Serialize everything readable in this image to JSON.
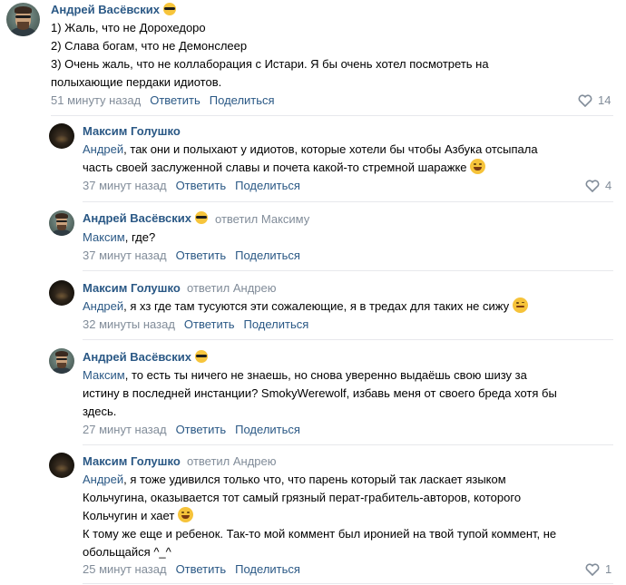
{
  "comments": [
    {
      "author": "Андрей Васёвских",
      "lines": [
        "1) Жаль, что не Дорохедоро",
        "2) Слава богам, что не Демонслеер",
        "3) Очень жаль, что не коллаборация с Истари. Я бы очень хотел посмотреть на",
        "полыхающие пердаки идиотов."
      ],
      "time": "51 минуту назад",
      "reply": "Ответить",
      "share": "Поделиться",
      "likes": "14"
    },
    {
      "author": "Максим Голушко",
      "mention": "Андрей",
      "lines": [
        ", так они и полыхают у идиотов, которые хотели бы чтобы Азбука отсыпала",
        "часть своей заслуженной славы и почета какой-то стремной шаражке"
      ],
      "time": "37 минут назад",
      "reply": "Ответить",
      "share": "Поделиться",
      "likes": "4"
    },
    {
      "author": "Андрей Васёвских",
      "reply_to": "ответил Максиму",
      "mention": "Максим",
      "text": ", где?",
      "time": "37 минут назад",
      "reply": "Ответить",
      "share": "Поделиться"
    },
    {
      "author": "Максим Голушко",
      "reply_to": "ответил Андрею",
      "mention": "Андрей",
      "text": ", я хз где там тусуются эти сожалеющие, я в тредах для таких не сижу",
      "time": "32 минуты назад",
      "reply": "Ответить",
      "share": "Поделиться"
    },
    {
      "author": "Андрей Васёвских",
      "mention": "Максим",
      "lines": [
        ", то есть ты ничего не знаешь, но снова уверенно выдаёшь свою шизу за",
        "истину в последней инстанции? SmokyWerewolf, избавь меня от своего бреда хотя бы",
        "здесь."
      ],
      "time": "27 минут назад",
      "reply": "Ответить",
      "share": "Поделиться"
    },
    {
      "author": "Максим Голушко",
      "reply_to": "ответил Андрею",
      "mention": "Андрей",
      "lines": [
        ", я тоже удивился только что, что парень который так ласкает языком",
        "Кольчугина, оказывается тот самый грязный перат-грабитель-авторов, которого",
        "Кольчугин и хает",
        "К тому же еще и ребенок. Так-то мой коммент был иронией на твой тупой коммент, не",
        "обольщайся ^_^"
      ],
      "time": "25 минут назад",
      "reply": "Ответить",
      "share": "Поделиться",
      "likes": "1"
    }
  ]
}
